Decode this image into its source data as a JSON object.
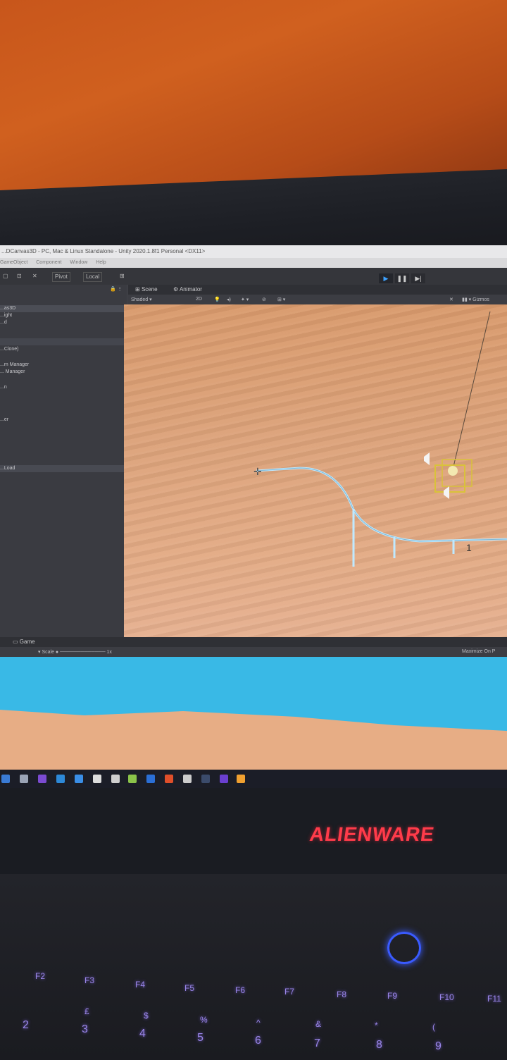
{
  "editor": {
    "title": "...DCanvas3D - PC, Mac & Linux Standalone - Unity 2020.1.8f1 Personal <DX11>",
    "menu": [
      "GameObject",
      "Component",
      "Window",
      "Help"
    ],
    "toolbar": {
      "pivot": "Pivot",
      "local": "Local"
    },
    "hierarchy_items": [
      "...as3D",
      "...ight",
      "...d",
      "...Clone)",
      "...m Manager",
      "... Manager",
      "...n",
      "...er",
      "...Load"
    ],
    "scene_tabs": [
      "Scene",
      "Animator"
    ],
    "shading_mode": "Shaded",
    "gizmos_label": "Gizmos",
    "game_tab": "Game",
    "scale_label": "Scale",
    "scale_value": "1x",
    "maximize_label": "Maximize On P"
  },
  "laptop": {
    "brand": "ALIENWARE"
  },
  "keyboard": {
    "fn_row": [
      "F2",
      "F3",
      "F4",
      "F5",
      "F6",
      "F7",
      "F8",
      "F9",
      "F10",
      "F11"
    ],
    "num_row": [
      "2",
      "3",
      "4",
      "5",
      "6",
      "7",
      "8",
      "9"
    ],
    "symbol_row": [
      "£",
      "$",
      "%",
      "^",
      "&",
      "*",
      "("
    ]
  },
  "colors": {
    "wall": "#c8561b",
    "sky": "#39b9e6",
    "sand": "#e7ad85",
    "play_active": "#3ea2ff",
    "track": "#bfe9ff",
    "brand": "#ff3b4a",
    "keyboard_glow": "#9a86e8"
  }
}
